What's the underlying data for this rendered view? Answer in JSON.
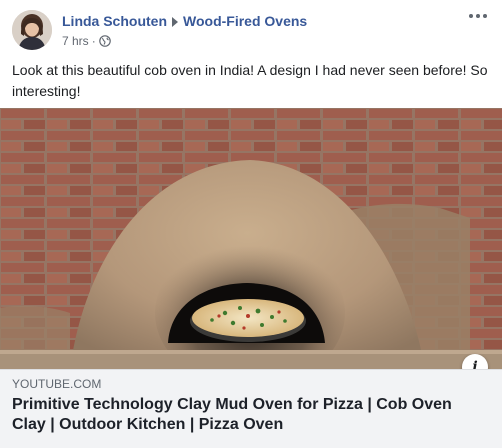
{
  "post": {
    "author": "Linda Schouten",
    "group": "Wood-Fired Ovens",
    "time": "7 hrs",
    "separator": "·",
    "privacy_icon": "globe-icon",
    "menu_icon": "more-options-icon",
    "text": "Look at this beautiful cob oven in India! A design I had never seen before! So interesting!"
  },
  "link": {
    "domain": "YOUTUBE.COM",
    "title": "Primitive Technology Clay Mud Oven for Pizza | Cob Oven Clay | Outdoor Kitchen | Pizza Oven",
    "info_label": "i"
  },
  "colors": {
    "link_name": "#385898",
    "meta_text": "#616770",
    "link_box_bg": "#f2f3f5"
  }
}
